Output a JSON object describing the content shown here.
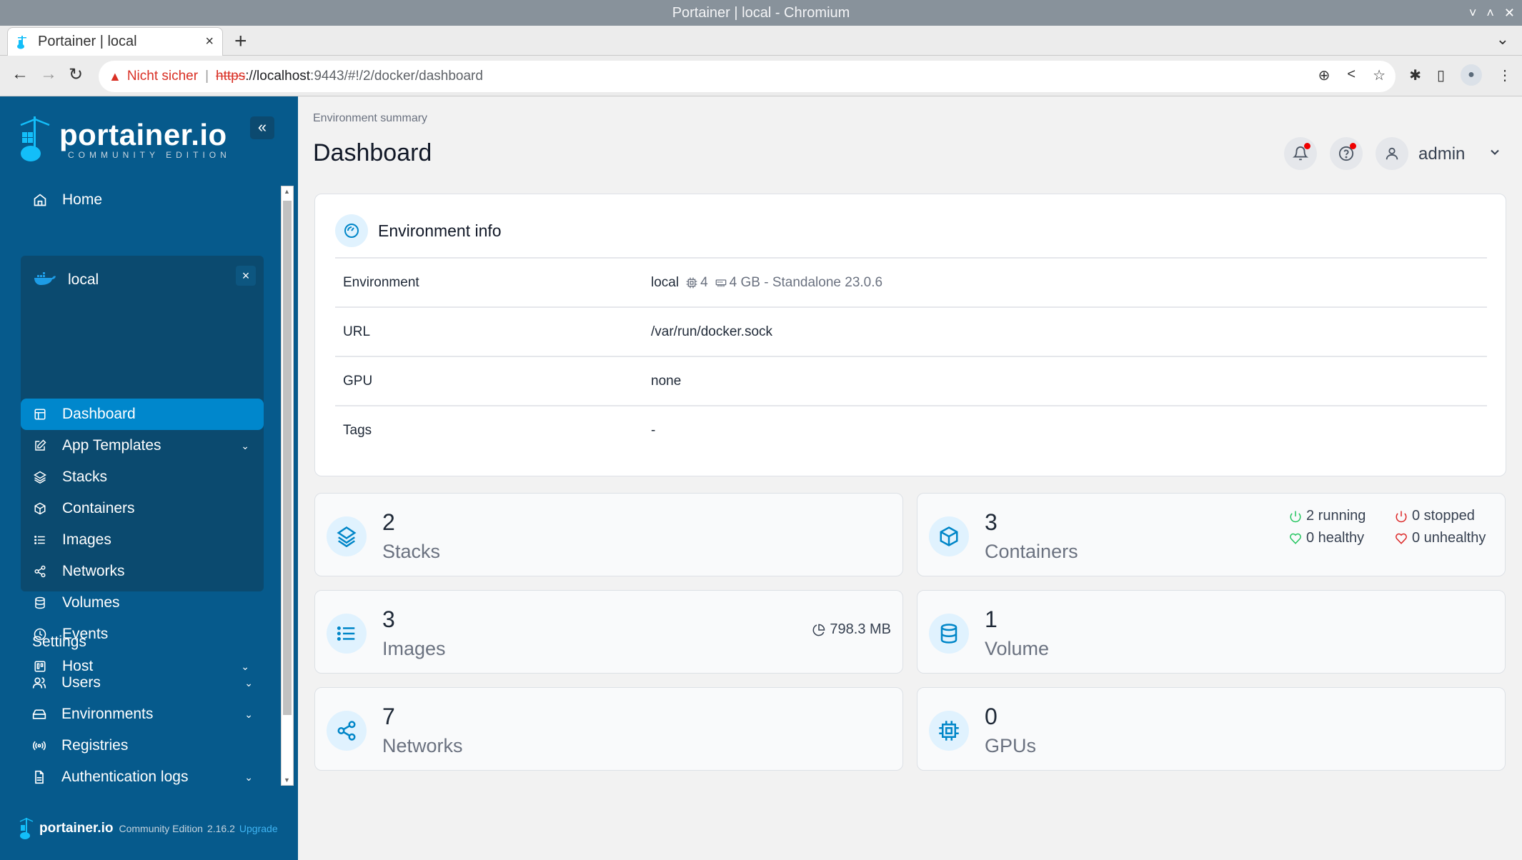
{
  "window": {
    "title": "Portainer | local - Chromium",
    "controls": [
      "˅",
      "˄",
      "✕"
    ]
  },
  "browser": {
    "tab_title": "Portainer | local",
    "tab_close": "×",
    "new_tab": "+",
    "security_label": "Nicht sicher",
    "url_scheme": "https",
    "url_host": "://localhost",
    "url_rest": ":9443/#!/2/docker/dashboard"
  },
  "sidebar": {
    "brand": "portainer.io",
    "edition": "COMMUNITY EDITION",
    "collapse": "«",
    "home": "Home",
    "environment": {
      "name": "local",
      "close": "×",
      "items": [
        {
          "label": "Dashboard",
          "icon": "dashboard-icon",
          "active": true,
          "expandable": false
        },
        {
          "label": "App Templates",
          "icon": "edit-icon",
          "active": false,
          "expandable": true
        },
        {
          "label": "Stacks",
          "icon": "layers-icon",
          "active": false,
          "expandable": false
        },
        {
          "label": "Containers",
          "icon": "box-icon",
          "active": false,
          "expandable": false
        },
        {
          "label": "Images",
          "icon": "list-icon",
          "active": false,
          "expandable": false
        },
        {
          "label": "Networks",
          "icon": "share-icon",
          "active": false,
          "expandable": false
        },
        {
          "label": "Volumes",
          "icon": "database-icon",
          "active": false,
          "expandable": false
        },
        {
          "label": "Events",
          "icon": "clock-icon",
          "active": false,
          "expandable": false
        },
        {
          "label": "Host",
          "icon": "trello-icon",
          "active": false,
          "expandable": true
        }
      ]
    },
    "settings_heading": "Settings",
    "settings": [
      {
        "label": "Users",
        "icon": "users-icon",
        "expandable": true
      },
      {
        "label": "Environments",
        "icon": "hard-drive-icon",
        "expandable": true
      },
      {
        "label": "Registries",
        "icon": "radio-icon",
        "expandable": false
      },
      {
        "label": "Authentication logs",
        "icon": "file-text-icon",
        "expandable": true
      }
    ],
    "footer": {
      "brand": "portainer.io",
      "edition": "Community Edition",
      "version": "2.16.2",
      "upgrade": "Upgrade"
    }
  },
  "header": {
    "breadcrumb": "Environment summary",
    "title": "Dashboard",
    "user": "admin"
  },
  "environment_info": {
    "title": "Environment info",
    "rows": [
      {
        "label": "Environment",
        "value": "local",
        "cpu": "4",
        "memory": "4 GB - Standalone 23.0.6"
      },
      {
        "label": "URL",
        "value": "/var/run/docker.sock"
      },
      {
        "label": "GPU",
        "value": "none"
      },
      {
        "label": "Tags",
        "value": "-"
      }
    ]
  },
  "stats": {
    "stacks": {
      "count": "2",
      "label": "Stacks"
    },
    "containers": {
      "count": "3",
      "label": "Containers",
      "running": "2 running",
      "stopped": "0 stopped",
      "healthy": "0 healthy",
      "unhealthy": "0 unhealthy"
    },
    "images": {
      "count": "3",
      "label": "Images",
      "size": "798.3 MB"
    },
    "volumes": {
      "count": "1",
      "label": "Volume"
    },
    "networks": {
      "count": "7",
      "label": "Networks"
    },
    "gpus": {
      "count": "0",
      "label": "GPUs"
    }
  },
  "colors": {
    "sidebar_bg": "#065a8c",
    "env_box_bg": "#0b4a6f",
    "active_item": "#0087cc",
    "accent_icon": "#0086c8",
    "running": "#22c55e",
    "stopped": "#dc2626"
  }
}
